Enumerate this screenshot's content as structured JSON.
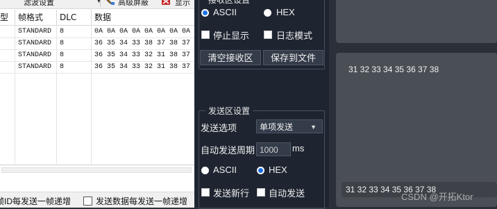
{
  "toolbar": {
    "filter_label": "滤波设置",
    "advanced_shield_label": "高级屏蔽",
    "display_label": "显示"
  },
  "grid": {
    "headers": [
      "型",
      "帧格式",
      "DLC",
      "数据"
    ],
    "rows": [
      {
        "format": "STANDARD",
        "dlc": "8",
        "data": "0A 0A 0A 0A 0A 0A 0A 0A"
      },
      {
        "format": "STANDARD",
        "dlc": "8",
        "data": "36 35 34 33 38 37 38 37"
      },
      {
        "format": "STANDARD",
        "dlc": "8",
        "data": "36 35 34 33 32 31 38 37"
      },
      {
        "format": "STANDARD",
        "dlc": "8",
        "data": "36 35 34 33 32 31 38 37"
      }
    ]
  },
  "bottom_options": {
    "frame_id_increment": "帧ID每发送一帧递增",
    "data_increment": "发送数据每发送一帧递增"
  },
  "receive_settings": {
    "title": "接收区设置",
    "ascii_label": "ASCII",
    "hex_label": "HEX",
    "stop_display_label": "停止显示",
    "log_mode_label": "日志模式",
    "clear_button": "清空接收区",
    "save_button": "保存到文件",
    "selected_mode": "ASCII"
  },
  "send_settings": {
    "title": "发送区设置",
    "send_option_label": "发送选项",
    "send_option_value": "单项发送",
    "auto_period_label": "自动发送周期",
    "auto_period_value": "1000",
    "auto_period_unit": "ms",
    "ascii_label": "ASCII",
    "hex_label": "HEX",
    "newline_label": "发送新行",
    "auto_send_label": "自动发送",
    "selected_mode": "HEX"
  },
  "receive_area": {
    "text": "31 32 33 34 35 36 37 38"
  },
  "send_area": {
    "text": "31 32 33 34 35 36 37 38"
  },
  "watermark": "CSDN @开拓Ktor",
  "colors": {
    "panel_dark": "#1e2531",
    "radio_selected": "#1e6fe3",
    "textbox": "#4a4e55",
    "splitter_marker": "#e8a33b"
  }
}
